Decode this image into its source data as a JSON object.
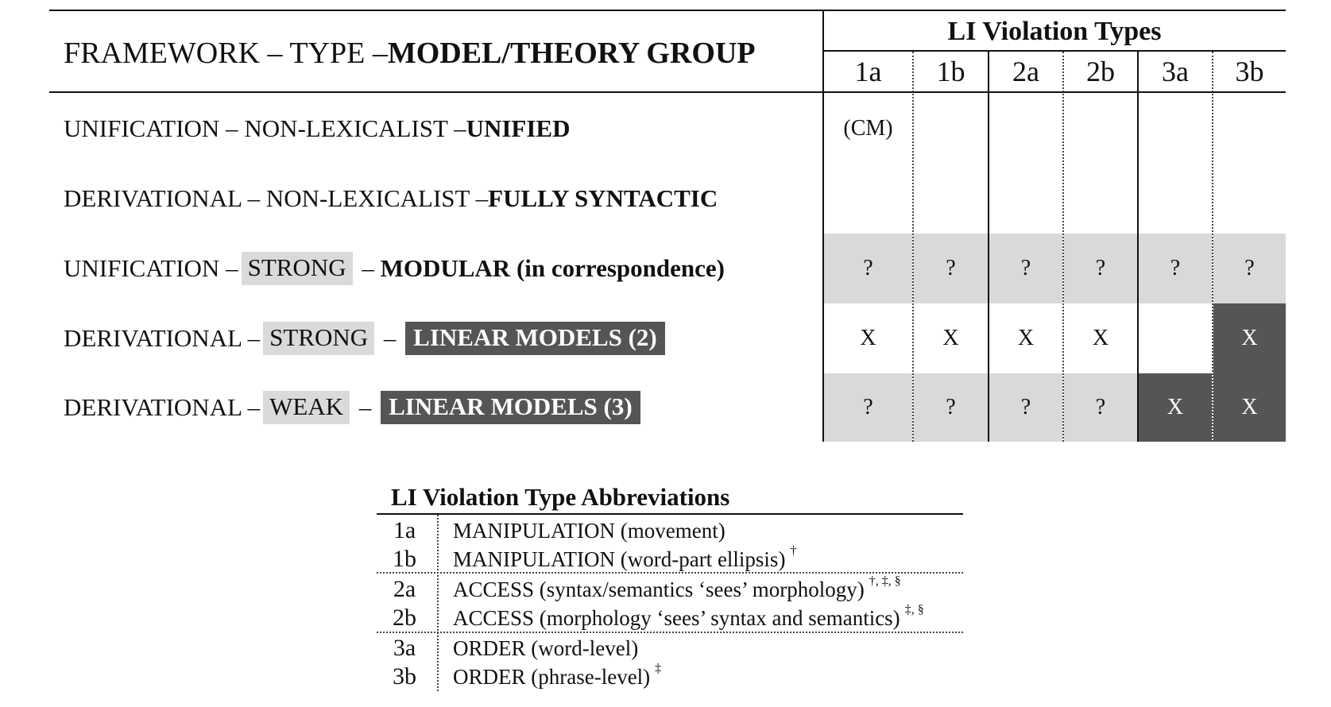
{
  "header": {
    "left_plain": "FRAMEWORK – TYPE – ",
    "left_bold": "MODEL/THEORY GROUP",
    "violation_title": "LI Violation Types",
    "columns": [
      "1a",
      "1b",
      "2a",
      "2b",
      "3a",
      "3b"
    ]
  },
  "rows": [
    {
      "framework": "UNIFICATION – NON-LEXICALIST – ",
      "group": "UNIFIED",
      "cells": [
        "(CM)",
        "",
        "",
        "",
        "",
        ""
      ]
    },
    {
      "framework": "DERIVATIONAL – NON-LEXICALIST – ",
      "group": "FULLY SYNTACTIC",
      "cells": [
        "",
        "",
        "",
        "",
        "",
        ""
      ]
    },
    {
      "framework_pre": "UNIFICATION – ",
      "type_tag": "STRONG",
      "framework_post": " – ",
      "group": "MODULAR (in correspondence)",
      "cells": [
        "?",
        "?",
        "?",
        "?",
        "?",
        "?"
      ]
    },
    {
      "framework_pre": "DERIVATIONAL – ",
      "type_tag": "STRONG",
      "framework_post": " – ",
      "group": "LINEAR MODELS (2)",
      "cells": [
        "X",
        "X",
        "X",
        "X",
        "",
        "X"
      ]
    },
    {
      "framework_pre": "DERIVATIONAL – ",
      "type_tag": "WEAK",
      "framework_post": " – ",
      "group": "LINEAR MODELS (3)",
      "cells": [
        "?",
        "?",
        "?",
        "?",
        "X",
        "X"
      ]
    }
  ],
  "colors": {
    "light_shade": "#d9d9d9",
    "dark_shade": "#555555"
  },
  "abbreviations": {
    "title": "LI Violation Type Abbreviations",
    "items": [
      {
        "code": "1a",
        "desc": "MANIPULATION (movement)",
        "marks": ""
      },
      {
        "code": "1b",
        "desc": "MANIPULATION (word-part ellipsis)",
        "marks": "†"
      },
      {
        "code": "2a",
        "desc": "ACCESS (syntax/semantics ‘sees’ morphology)",
        "marks": "†, ‡, §"
      },
      {
        "code": "2b",
        "desc": "ACCESS (morphology ‘sees’ syntax and semantics)",
        "marks": "‡, §"
      },
      {
        "code": "3a",
        "desc": "ORDER (word-level)",
        "marks": ""
      },
      {
        "code": "3b",
        "desc": "ORDER (phrase-level)",
        "marks": "‡"
      }
    ]
  }
}
